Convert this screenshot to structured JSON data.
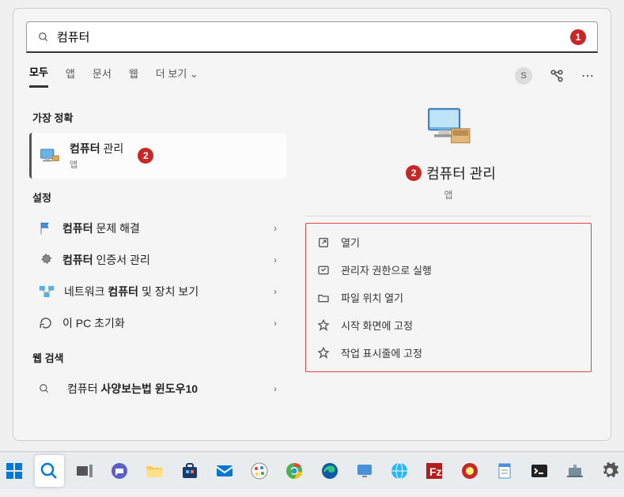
{
  "search": {
    "query": "컴퓨터",
    "badge": "1"
  },
  "tabs": {
    "all": "모두",
    "apps": "앱",
    "docs": "문서",
    "web": "웹",
    "more": "더 보기"
  },
  "avatar_initial": "S",
  "sections": {
    "best": "가장 정확",
    "settings": "설정",
    "web": "웹 검색"
  },
  "results": {
    "best": {
      "title_bold": "컴퓨터",
      "title_rest": " 관리",
      "sub": "앱",
      "badge": "2"
    },
    "settings": [
      {
        "bold": "컴퓨터",
        "rest": " 문제 해결"
      },
      {
        "bold": "컴퓨터",
        "rest": " 인증서 관리"
      },
      {
        "pre": "네트워크 ",
        "bold": "컴퓨터",
        "rest": " 및 장치 보기"
      },
      {
        "pre": "이 PC 초기화",
        "bold": "",
        "rest": ""
      }
    ],
    "web": [
      {
        "pre": "컴퓨터 ",
        "bold": "사양보는법 윈도우10",
        "rest": ""
      }
    ]
  },
  "preview": {
    "badge": "2",
    "title": "컴퓨터 관리",
    "sub": "앱",
    "actions": [
      "열기",
      "관리자 권한으로 실행",
      "파일 위치 열기",
      "시작 화면에 고정",
      "작업 표시줄에 고정"
    ]
  },
  "taskbar": {
    "items": [
      "start",
      "search",
      "taskview",
      "chat",
      "explorer",
      "store",
      "mail",
      "paint",
      "chrome",
      "edge",
      "remote",
      "browser2",
      "filezilla",
      "av",
      "notes",
      "terminal",
      "device",
      "settings"
    ]
  }
}
